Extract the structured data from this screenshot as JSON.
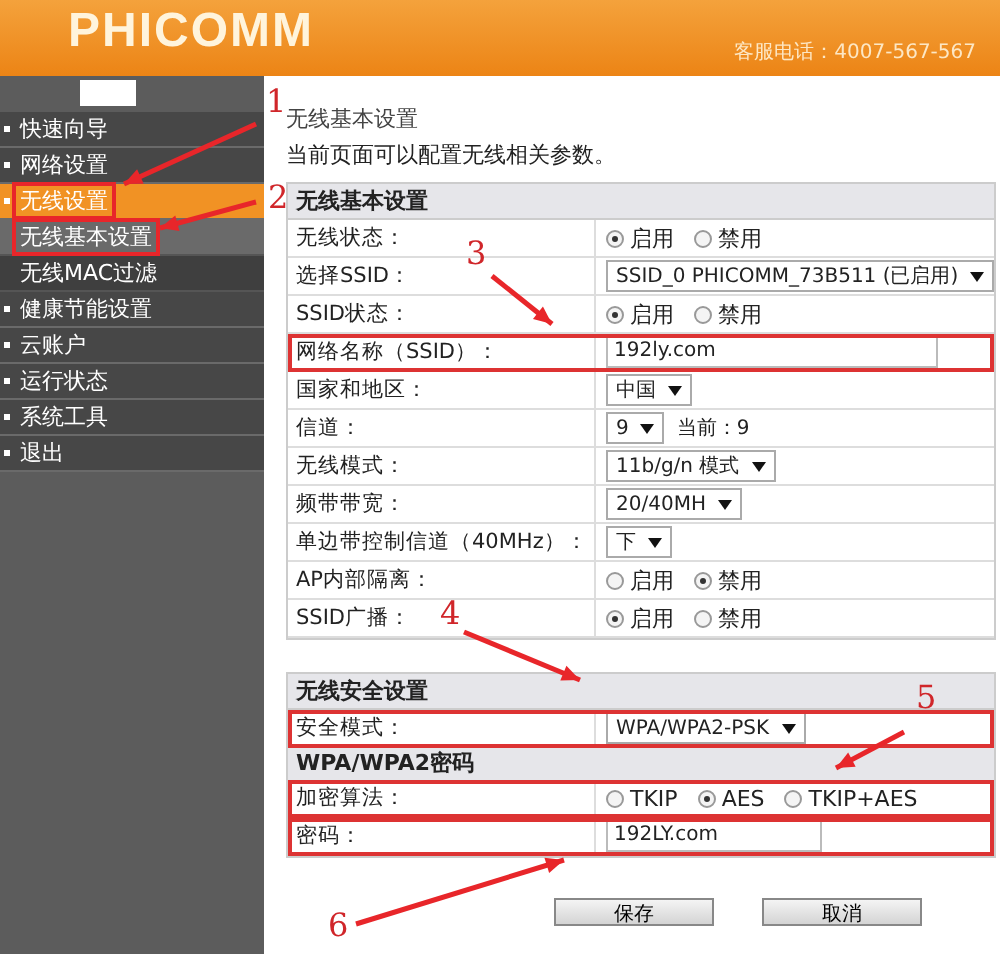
{
  "header": {
    "logo": "PHICOMM",
    "hotline": "客服电话：4007-567-567"
  },
  "sidebar": {
    "items": [
      {
        "label": "快速向导",
        "selected": false,
        "highlighted": false
      },
      {
        "label": "网络设置",
        "selected": false,
        "highlighted": false
      },
      {
        "label": "无线设置",
        "selected": true,
        "highlighted": true,
        "expanded": true,
        "children": [
          {
            "label": "无线基本设置",
            "selected": true,
            "highlighted": true
          },
          {
            "label": "无线MAC过滤",
            "selected": false,
            "highlighted": false
          }
        ]
      },
      {
        "label": "健康节能设置",
        "selected": false,
        "highlighted": false
      },
      {
        "label": "云账户",
        "selected": false,
        "highlighted": false
      },
      {
        "label": "运行状态",
        "selected": false,
        "highlighted": false
      },
      {
        "label": "系统工具",
        "selected": false,
        "highlighted": false
      },
      {
        "label": "退出",
        "selected": false,
        "highlighted": false
      }
    ]
  },
  "page": {
    "title": "无线基本设置",
    "description": "当前页面可以配置无线相关参数。"
  },
  "sections": [
    {
      "title": "无线基本设置",
      "rows": [
        {
          "kind": "radio",
          "label": "无线状态：",
          "highlighted": false,
          "options": [
            {
              "label": "启用",
              "selected": true
            },
            {
              "label": "禁用",
              "selected": false
            }
          ]
        },
        {
          "kind": "select",
          "label": "选择SSID：",
          "highlighted": false,
          "value": "SSID_0 PHICOMM_73B511 (已启用)"
        },
        {
          "kind": "radio",
          "label": "SSID状态：",
          "highlighted": false,
          "options": [
            {
              "label": "启用",
              "selected": true
            },
            {
              "label": "禁用",
              "selected": false
            }
          ]
        },
        {
          "kind": "input",
          "label": "网络名称（SSID）：",
          "highlighted": true,
          "value": "192ly.com"
        },
        {
          "kind": "select",
          "label": "国家和地区：",
          "highlighted": false,
          "value": "中国"
        },
        {
          "kind": "select",
          "label": "信道：",
          "highlighted": false,
          "value": "9",
          "note": "当前：9"
        },
        {
          "kind": "select",
          "label": "无线模式：",
          "highlighted": false,
          "value": "11b/g/n 模式"
        },
        {
          "kind": "select",
          "label": "频带带宽：",
          "highlighted": false,
          "value": "20/40MH"
        },
        {
          "kind": "select",
          "label": "单边带控制信道（40MHz）：",
          "highlighted": false,
          "value": "下"
        },
        {
          "kind": "radio",
          "label": "AP内部隔离：",
          "highlighted": false,
          "options": [
            {
              "label": "启用",
              "selected": false
            },
            {
              "label": "禁用",
              "selected": true
            }
          ]
        },
        {
          "kind": "radio",
          "label": "SSID广播：",
          "highlighted": false,
          "options": [
            {
              "label": "启用",
              "selected": true
            },
            {
              "label": "禁用",
              "selected": false
            }
          ]
        }
      ]
    },
    {
      "title": "无线安全设置",
      "rows": [
        {
          "kind": "select",
          "label": "安全模式：",
          "highlighted": true,
          "value": "WPA/WPA2-PSK"
        },
        {
          "kind": "subheader",
          "label": "WPA/WPA2密码"
        },
        {
          "kind": "radio",
          "label": "加密算法：",
          "highlighted": true,
          "options": [
            {
              "label": "TKIP",
              "selected": false
            },
            {
              "label": "AES",
              "selected": true
            },
            {
              "label": "TKIP+AES",
              "selected": false
            }
          ]
        },
        {
          "kind": "input",
          "label": "密码：",
          "highlighted": true,
          "value": "192LY.com"
        }
      ]
    }
  ],
  "buttons": [
    "保存",
    "取消"
  ],
  "annotations": [
    {
      "label": "1"
    },
    {
      "label": "2"
    },
    {
      "label": "3"
    },
    {
      "label": "4"
    },
    {
      "label": "5"
    },
    {
      "label": "6"
    }
  ]
}
